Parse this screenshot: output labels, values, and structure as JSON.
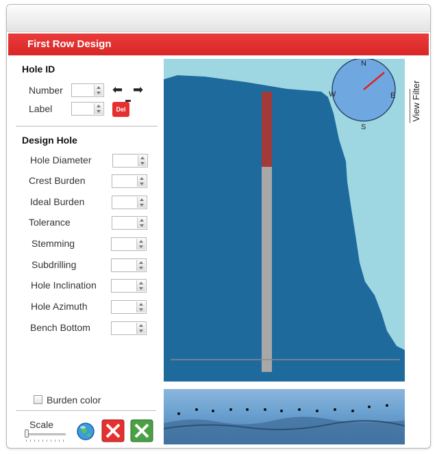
{
  "panel_title": "First Row Design",
  "hole_id": {
    "title": "Hole ID",
    "number_label": "Number",
    "label_label": "Label",
    "del_label": "Del"
  },
  "design_hole": {
    "title": "Design Hole",
    "fields": [
      {
        "label": "Hole Diameter"
      },
      {
        "label": "Crest Burden"
      },
      {
        "label": "Ideal Burden"
      },
      {
        "label": "Tolerance"
      },
      {
        "label": "Stemming"
      },
      {
        "label": "Subdrilling"
      },
      {
        "label": "Hole Inclination"
      },
      {
        "label": "Hole Azimuth"
      },
      {
        "label": "Bench Bottom"
      }
    ]
  },
  "compass": {
    "n": "N",
    "e": "E",
    "s": "S",
    "w": "W"
  },
  "view_filter_label": "View Filter",
  "burden_color_label": "Burden color",
  "scale_label": "Scale",
  "colors": {
    "accent": "#e03030",
    "rock": "#1f6a9c",
    "sky": "#9ed7e2",
    "hole_top": "#a33a3a",
    "hole_body": "#a8a8a8"
  },
  "icons": [
    "arrow-left-icon",
    "arrow-right-icon",
    "globe-icon",
    "cancel-icon",
    "confirm-icon",
    "compass-icon"
  ]
}
